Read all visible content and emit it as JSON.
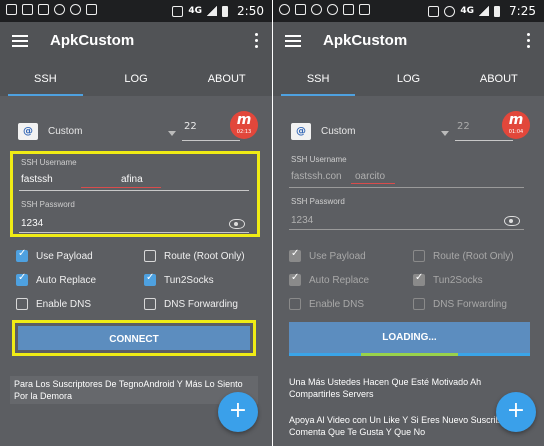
{
  "left": {
    "status": {
      "clock": "2:50",
      "network": "4G"
    },
    "app_title": "ApkCustom",
    "tabs": [
      "SSH",
      "LOG",
      "ABOUT"
    ],
    "server": {
      "name": "Custom",
      "port": "22",
      "timer": "02:13"
    },
    "username": {
      "label": "SSH Username",
      "value": "fastssh",
      "suffix": "afina"
    },
    "password": {
      "label": "SSH Password",
      "value": "1234"
    },
    "options": [
      {
        "label": "Use Payload",
        "checked": true
      },
      {
        "label": "Route (Root Only)",
        "checked": false
      },
      {
        "label": "Auto Replace",
        "checked": true
      },
      {
        "label": "Tun2Socks",
        "checked": true
      },
      {
        "label": "Enable DNS",
        "checked": false
      },
      {
        "label": "DNS Forwarding",
        "checked": false
      }
    ],
    "button": "CONNECT",
    "message": "Para Los Suscriptores De TegnoAndroid Y Más Lo Siento Por la Demora",
    "fab": "+"
  },
  "right": {
    "status": {
      "clock": "7:25",
      "network": "4G"
    },
    "app_title": "ApkCustom",
    "tabs": [
      "SSH",
      "LOG",
      "ABOUT"
    ],
    "server": {
      "name": "Custom",
      "port": "22",
      "timer": "01:04"
    },
    "username": {
      "label": "SSH Username",
      "value": "fastssh.con",
      "suffix": "oarcito"
    },
    "password": {
      "label": "SSH Password",
      "value": "1234"
    },
    "options": [
      {
        "label": "Use Payload",
        "checked": true
      },
      {
        "label": "Route (Root Only)",
        "checked": false
      },
      {
        "label": "Auto Replace",
        "checked": true
      },
      {
        "label": "Tun2Socks",
        "checked": true
      },
      {
        "label": "Enable DNS",
        "checked": false
      },
      {
        "label": "DNS Forwarding",
        "checked": false
      }
    ],
    "button": "LOADING...",
    "message1": "Una Más Ustedes Hacen Que Esté Motivado Ah Compartirles Servers",
    "message2": "Apoya Al Video con Un Like Y Si Eres Nuevo Suscribete Y Comenta Que Te Gusta Y Que No",
    "fab": "+"
  },
  "colors": {
    "highlight": "#f0ec15",
    "accent": "#4ea1e0",
    "timer": "#e2473b"
  }
}
